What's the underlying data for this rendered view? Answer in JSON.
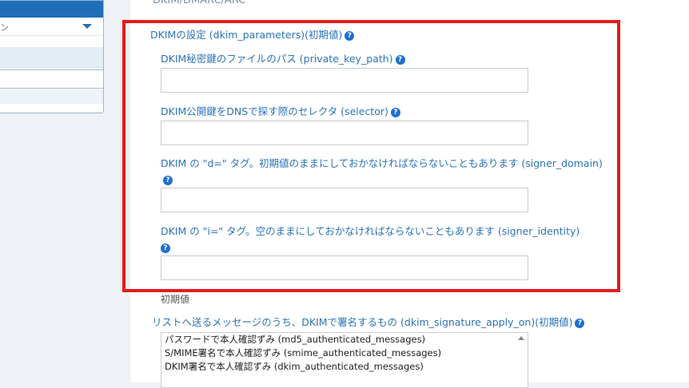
{
  "section": {
    "heading": "DKIM/DMARC/ARC"
  },
  "dkim_parameters": {
    "label": "DKIMの設定 (dkim_parameters)(初期値)",
    "fields": [
      {
        "label": "DKIM秘密鍵のファイルのパス (private_key_path)",
        "value": ""
      },
      {
        "label": "DKIM公開鍵をDNSで探す際のセレクタ (selector)",
        "value": ""
      },
      {
        "label": "DKIM の \"d=\" タグ。初期値のままにしておかなければならないこともあります (signer_domain)",
        "value": ""
      },
      {
        "label": "DKIM の \"i=\" タグ。空のままにしておかなければならないこともあります (signer_identity)",
        "value": ""
      }
    ],
    "default_note": "初期値"
  },
  "signature_apply": {
    "label": "リストへ送るメッセージのうち、DKIMで署名するもの (dkim_signature_apply_on)(初期値)",
    "options": [
      "パスワードで本人確認ずみ (md5_authenticated_messages)",
      "S/MIME署名で本人確認ずみ (smime_authenticated_messages)",
      "DKIM署名で本人確認ずみ (dkim_authenticated_messages)"
    ]
  },
  "help_glyph": "?",
  "sidebar": {
    "select_caret": "chevron-down-icon",
    "select_text": "ン"
  },
  "colors": {
    "accent": "#1e6fb8",
    "label_blue": "#2c73b8",
    "highlight_red": "#e31b1b",
    "help_badge": "#1e6fd1"
  }
}
